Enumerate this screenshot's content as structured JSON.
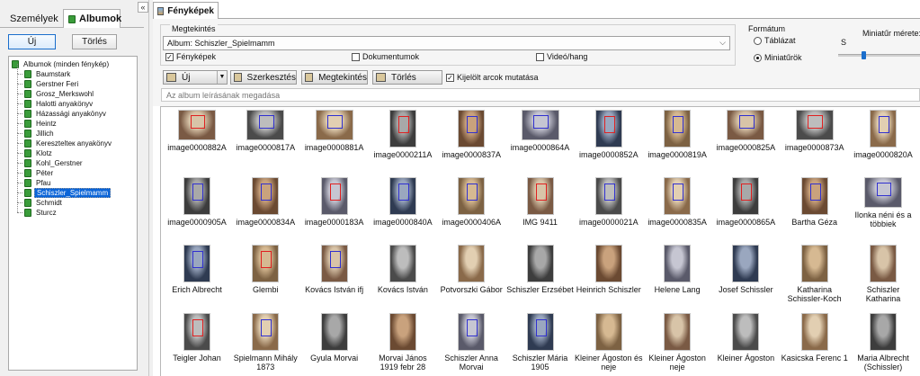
{
  "left_panel": {
    "tabs": [
      {
        "label": "Személyek"
      },
      {
        "label": "Albumok"
      }
    ],
    "collapse_glyph": "«",
    "new_label": "Új",
    "delete_label": "Törlés",
    "tree_root": "Albumok (minden fénykép)",
    "albums": [
      "Baumstark",
      "Gerstner Feri",
      "Grosz_Merkswohl",
      "Halotti anyakönyv",
      "Házassági anyakönyv",
      "Heintz",
      "Jillich",
      "Keresztelteк anyakönyv",
      "Klotz",
      "Kohl_Gerstner",
      "Péter",
      "Pfau",
      "Schiszler_Spielmamm",
      "Schmidt",
      "Sturcz"
    ],
    "selected_album": "Schiszler_Spielmamm"
  },
  "main": {
    "tab_label": "Fényképek",
    "view_group_title": "Megtekintés",
    "album_value": "Album: Schiszler_Spielmamm",
    "checkboxes": [
      {
        "label": "Fényképek",
        "checked": true
      },
      {
        "label": "Dokumentumok",
        "checked": false
      },
      {
        "label": "Videó/hang",
        "checked": false
      }
    ],
    "format_title": "Formátum",
    "format_options": [
      {
        "label": "Táblázat",
        "selected": false
      },
      {
        "label": "Miniatűrök",
        "selected": true
      }
    ],
    "thumb_size_label": "Miniatűr mérete:",
    "slider_letter": "S",
    "thumb_size_fraction": 0.3,
    "toolbar": {
      "new": "Új",
      "edit": "Szerkesztés",
      "view": "Megtekintés",
      "delete": "Törlés",
      "show_faces": "Kijelölt arcok mutatása",
      "show_faces_checked": true
    },
    "search_placeholder": "Az album leírásának megadása",
    "check_glyph": "✓"
  },
  "thumbnails": [
    [
      "image0000882A",
      "image0000817A",
      "image0000881A",
      "image0000211A",
      "image0000837A",
      "image0000864A",
      "image0000852A",
      "image0000819A",
      "image0000825A",
      "image0000873A",
      "image0000820A"
    ],
    [
      "image0000905A",
      "image0000834A",
      "image0000183A",
      "image0000840A",
      "image0000406A",
      "IMG 9411",
      "image0000021A",
      "image0000835A",
      "image0000865A",
      "Bartha Géza",
      "Ilonka néni és a többiek"
    ],
    [
      "Erich Albrecht",
      "Glembi",
      "Kovács István ifj",
      "Kovács István",
      "Potvorszki Gábor",
      "Schiszler Erzsébet",
      "Heinrich Schiszler",
      "Helene Lang",
      "Josef Schissler",
      "Katharina Schissler-Koch",
      "Schiszler Katharina"
    ],
    [
      "Teigler Johan",
      "Spielmann Mihály 1873",
      "Gyula Morvai",
      "Morvai János 1919 febr 28",
      "Schiszler Anna Morvai",
      "Schiszler Mária 1905",
      "Kleiner Ágoston és neje",
      "Kleiner Ágoston neje",
      "Kleiner Ágoston",
      "Kasicska Ferenc 1",
      "Maria Albrecht (Schissler)"
    ]
  ],
  "colors": {
    "selection": "#0a64d8",
    "face_box": "#3030d0",
    "face_box_red": "#e02020",
    "album_icon": "#3a9c3a"
  }
}
